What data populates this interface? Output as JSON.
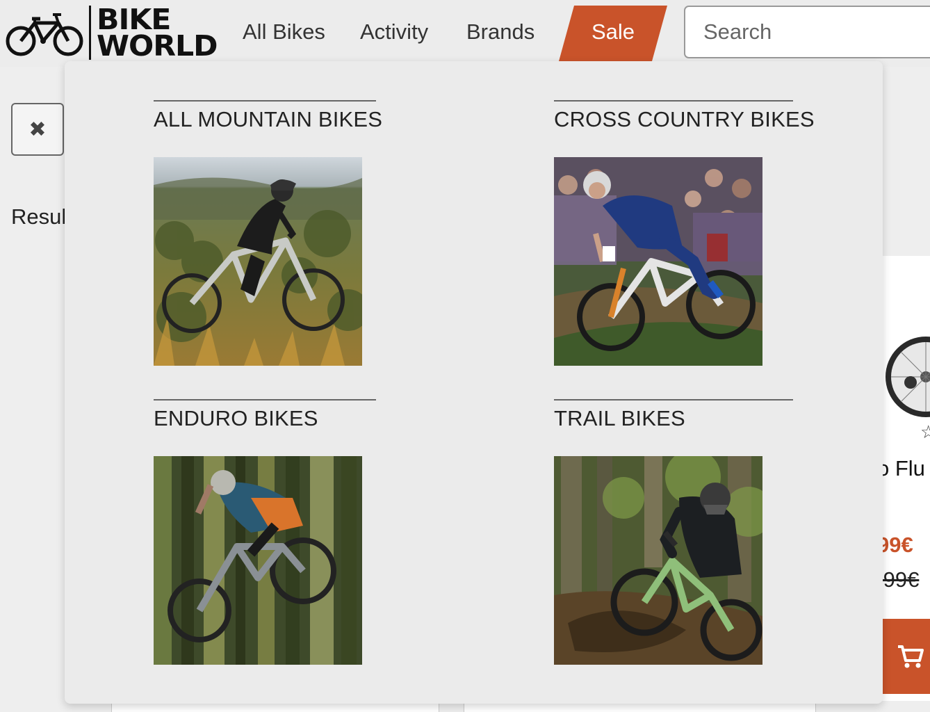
{
  "header": {
    "logo_line1": "BIKE",
    "logo_line2": "WORLD",
    "nav": [
      {
        "label": "All Bikes"
      },
      {
        "label": "Activity"
      },
      {
        "label": "Brands"
      },
      {
        "label": "Sale"
      }
    ],
    "search_placeholder": "Search"
  },
  "page": {
    "results_label": "Resul",
    "product": {
      "name": "o Flu",
      "price": "99€",
      "old_price": ".99€"
    }
  },
  "dropdown": {
    "categories": [
      {
        "title": "ALL MOUNTAIN BIKES"
      },
      {
        "title": "CROSS COUNTRY BIKES"
      },
      {
        "title": "ENDURO BIKES"
      },
      {
        "title": "TRAIL BIKES"
      }
    ]
  },
  "colors": {
    "accent": "#c9532a",
    "header_bg": "#ececec",
    "dropdown_bg": "#ebebeb"
  }
}
